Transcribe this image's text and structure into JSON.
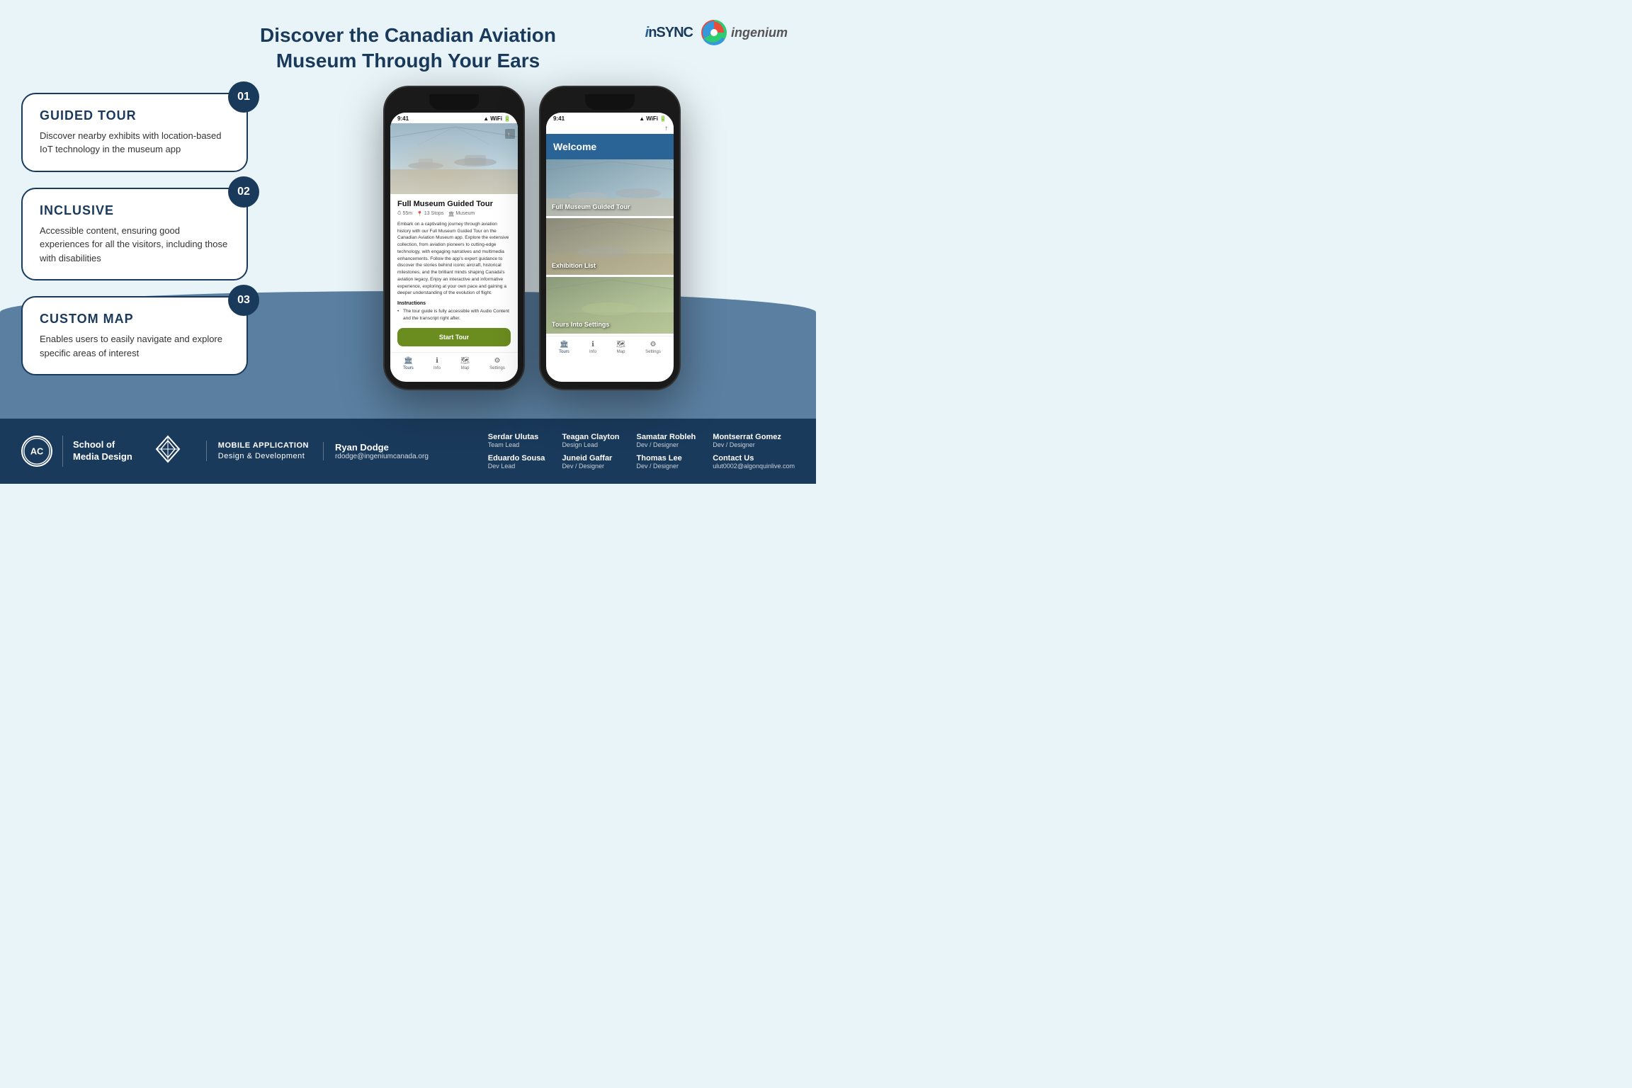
{
  "header": {
    "title_line1": "Discover the Canadian Aviation",
    "title_line2": "Museum Through Your Ears",
    "logos": {
      "insync": "inSYNC",
      "ingenium": "ingenium"
    }
  },
  "features": [
    {
      "number": "01",
      "title": "GUIDED TOUR",
      "description": "Discover nearby exhibits with location-based IoT technology in the museum app"
    },
    {
      "number": "02",
      "title": "INCLUSIVE",
      "description": "Accessible content, ensuring good experiences for all the visitors, including those with disabilities"
    },
    {
      "number": "03",
      "title": "CUSTOM MAP",
      "description": "Enables users to easily navigate and explore specific areas of interest"
    }
  ],
  "phone1": {
    "status_time": "9:41",
    "tour_title": "Full Museum Guided Tour",
    "meta_duration": "55m",
    "meta_stops": "13 Stops",
    "meta_type": "Museum",
    "description": "Embark on a captivating journey through aviation history with our Full Museum Guided Tour on the Canadian Aviation Museum app. Explore the extensive collection, from aviation pioneers to cutting-edge technology, with engaging narratives and multimedia enhancements. Follow the app's expert guidance to discover the stories behind iconic aircraft, historical milestones, and the brilliant minds shaping Canada's aviation legacy. Enjoy an interactive and informative experience, exploring at your own pace and gaining a deeper understanding of the evolution of flight.",
    "instructions_title": "Instructions",
    "instruction_text": "The tour guide is fully accessible with Audio Content and the transcript right after.",
    "start_tour_label": "Start Tour",
    "nav_items": [
      {
        "icon": "🏛",
        "label": "Tours",
        "active": true
      },
      {
        "icon": "ℹ",
        "label": "Info",
        "active": false
      },
      {
        "icon": "🗺",
        "label": "Map",
        "active": false
      },
      {
        "icon": "⚙",
        "label": "Settings",
        "active": false
      }
    ]
  },
  "phone2": {
    "status_time": "9:41",
    "welcome_title": "Welcome",
    "tour_cards": [
      {
        "label": "Full Museum Guided Tour"
      },
      {
        "label": "Exhibition List"
      },
      {
        "label": "Tours Into Settings"
      }
    ],
    "nav_items": [
      {
        "icon": "🏛",
        "label": "Tours",
        "active": true
      },
      {
        "icon": "ℹ",
        "label": "Info",
        "active": false
      },
      {
        "icon": "🗺",
        "label": "Map",
        "active": false
      },
      {
        "icon": "⚙",
        "label": "Settings",
        "active": false
      }
    ]
  },
  "footer": {
    "school_name_line1": "School of",
    "school_name_line2": "Media Design",
    "ac_letters": "AC",
    "program_line1": "MOBILE APPLICATION",
    "program_line2": "Design & Development",
    "lead_name": "Ryan Dodge",
    "lead_email": "rdodge@ingeniumcanada.org",
    "team_members": [
      {
        "name": "Serdar Ulutas",
        "role": "Team Lead"
      },
      {
        "name": "Eduardo Sousa",
        "role": "Dev Lead"
      },
      {
        "name": "Teagan Clayton",
        "role": "Design Lead"
      },
      {
        "name": "Juneid Gaffar",
        "role": "Dev / Designer"
      },
      {
        "name": "Samatar Robleh",
        "role": "Dev / Designer"
      },
      {
        "name": "Thomas Lee",
        "role": "Dev / Designer"
      },
      {
        "name": "Montserrat Gomez",
        "role": "Dev / Designer"
      }
    ],
    "contact_label": "Contact Us",
    "contact_email": "ulut0002@algonquinlive.com"
  }
}
